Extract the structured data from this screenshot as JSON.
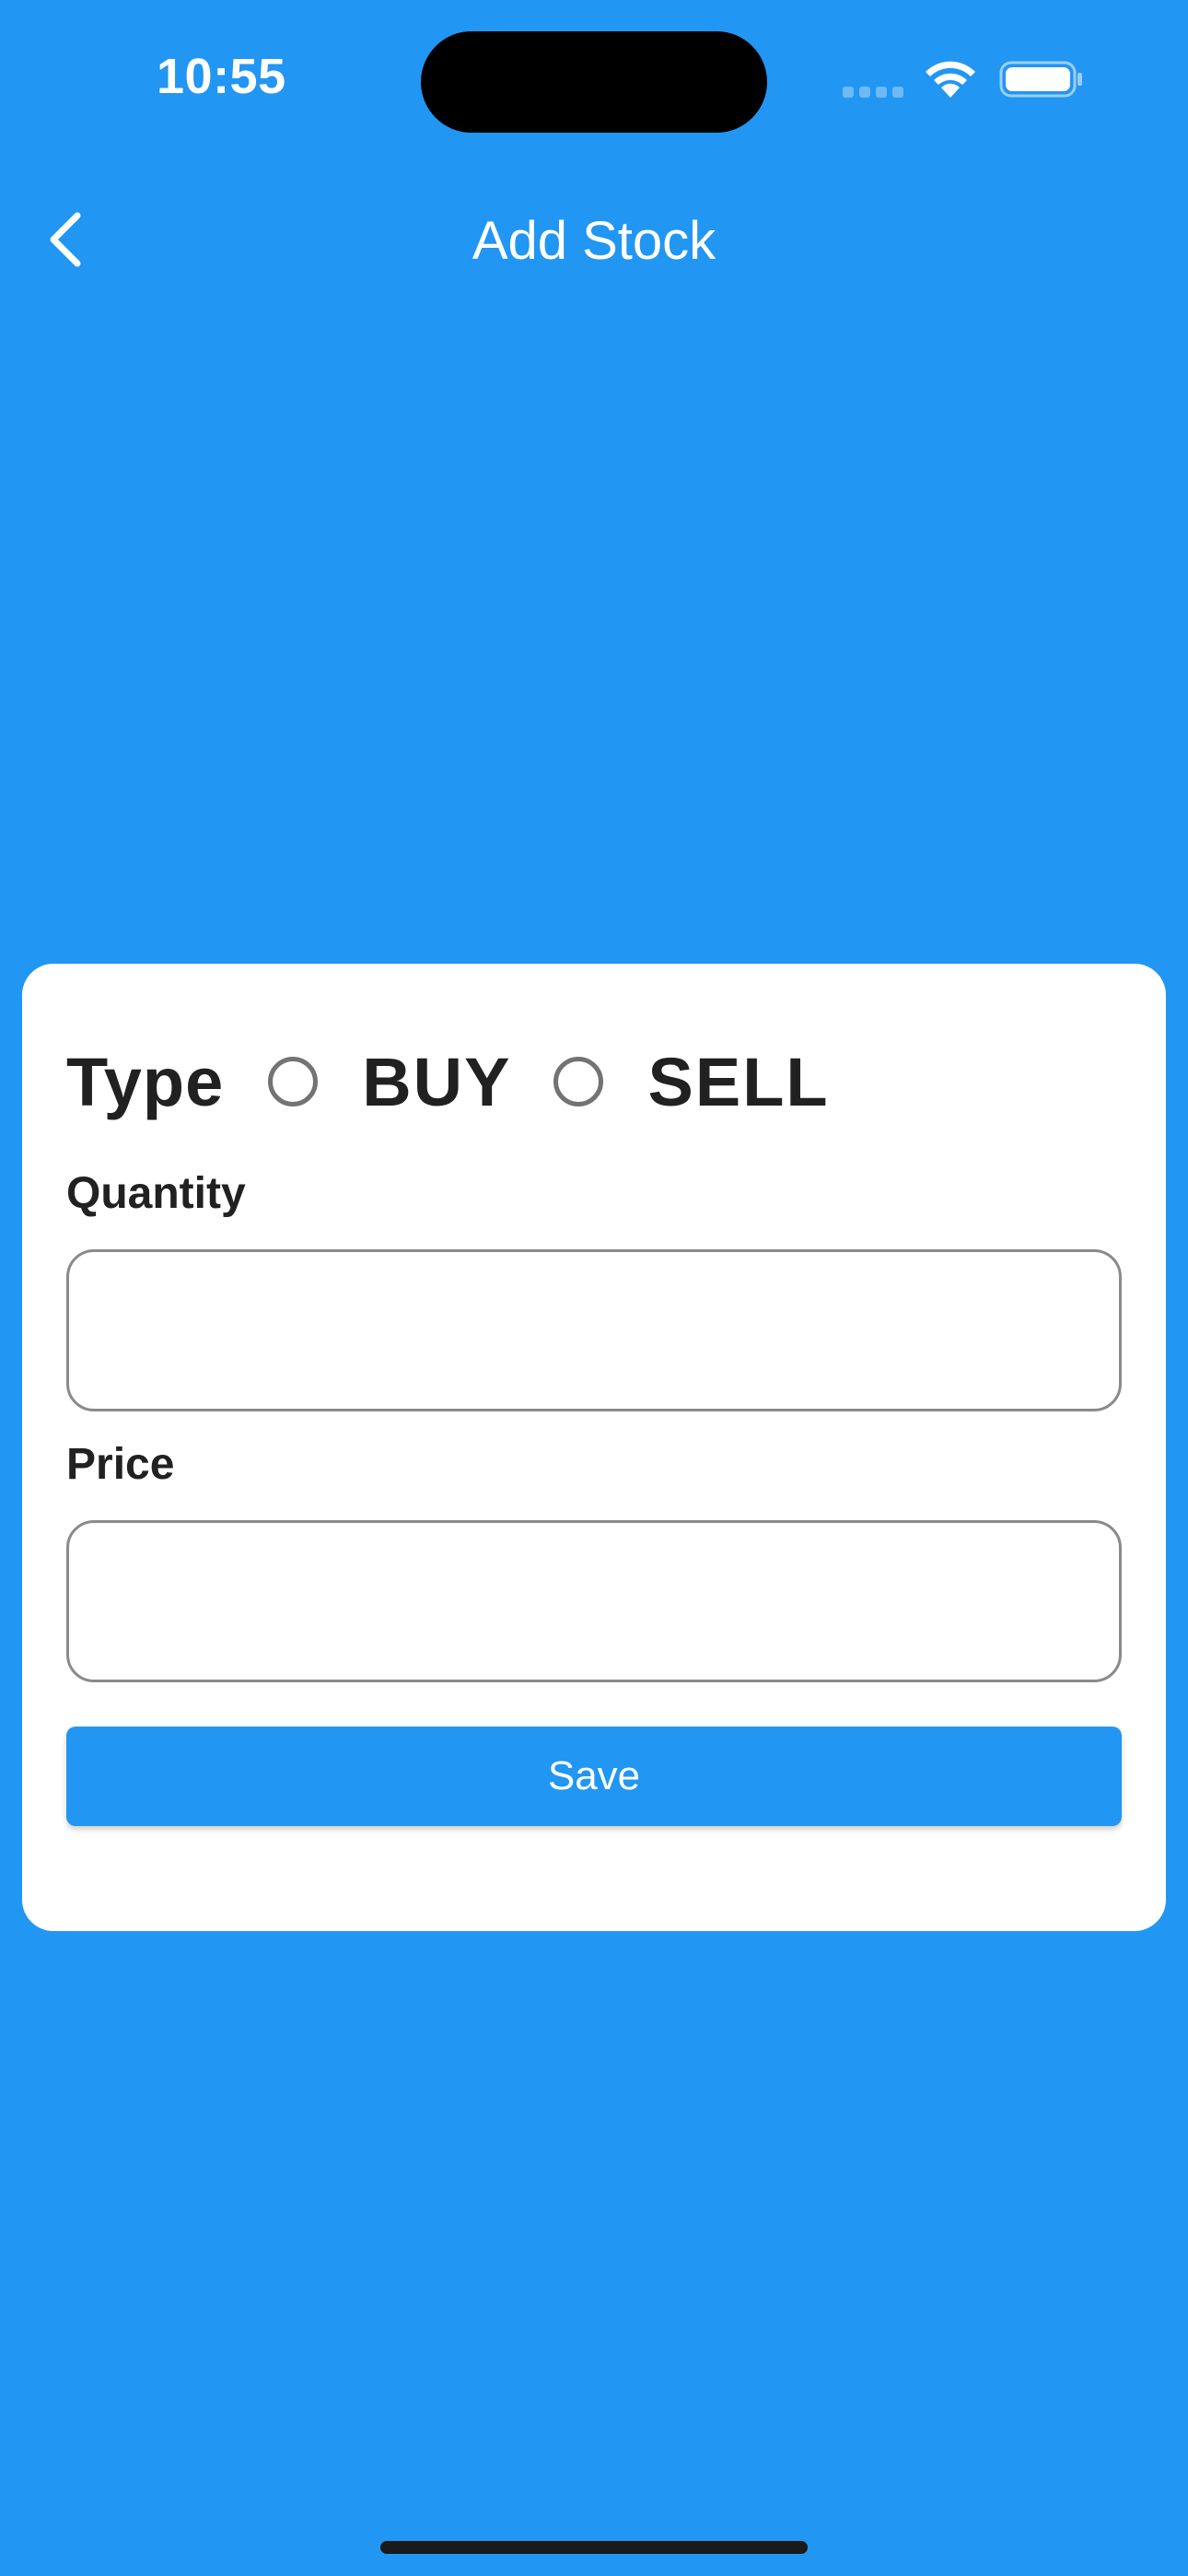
{
  "status_bar": {
    "time": "10:55",
    "icons": [
      "signal-icon",
      "wifi-icon",
      "battery-icon"
    ]
  },
  "nav": {
    "title": "Add Stock",
    "back_icon": "chevron-left-icon"
  },
  "form": {
    "type_label": "Type",
    "type_options": [
      "BUY",
      "SELL"
    ],
    "selected_type": null,
    "quantity_label": "Quantity",
    "quantity_value": "",
    "price_label": "Price",
    "price_value": "",
    "save_label": "Save"
  },
  "colors": {
    "primary": "#2196F3",
    "card": "#FFFFFF",
    "text": "#212121",
    "border": "#8A8A8A"
  }
}
